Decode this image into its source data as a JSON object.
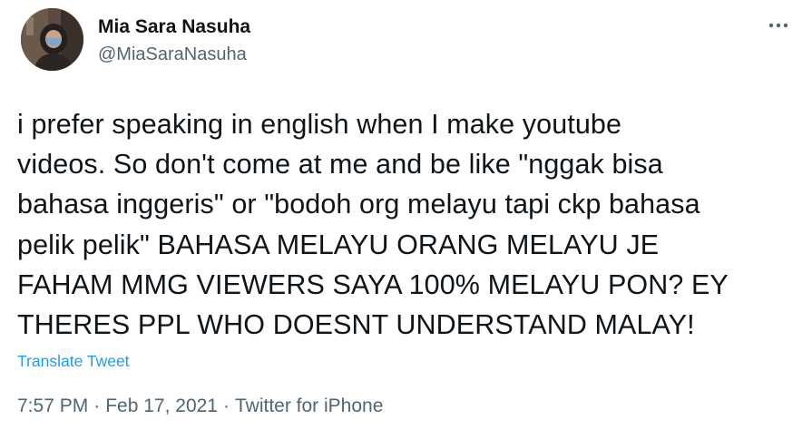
{
  "author": {
    "display_name": "Mia Sara Nasuha",
    "handle": "@MiaSaraNasuha"
  },
  "tweet": {
    "text": "i prefer speaking in english when I make youtube\nvideos. So don't come at me and be like \"nggak bisa\nbahasa inggeris\" or \"bodoh org melayu tapi ckp bahasa\npelik pelik\" BAHASA MELAYU ORANG MELAYU JE\nFAHAM MMG VIEWERS SAYA 100% MELAYU PON? EY\nTHERES PPL WHO DOESNT UNDERSTAND MALAY!",
    "translate_label": "Translate Tweet",
    "time": "7:57 PM",
    "separator": "·",
    "date": "Feb 17, 2021",
    "source": "Twitter for iPhone"
  },
  "icons": {
    "more": "more-horizontal-icon",
    "avatar": "profile-photo"
  },
  "colors": {
    "text_primary": "#0f1419",
    "text_secondary": "#536471",
    "link": "#1d9bf0"
  }
}
